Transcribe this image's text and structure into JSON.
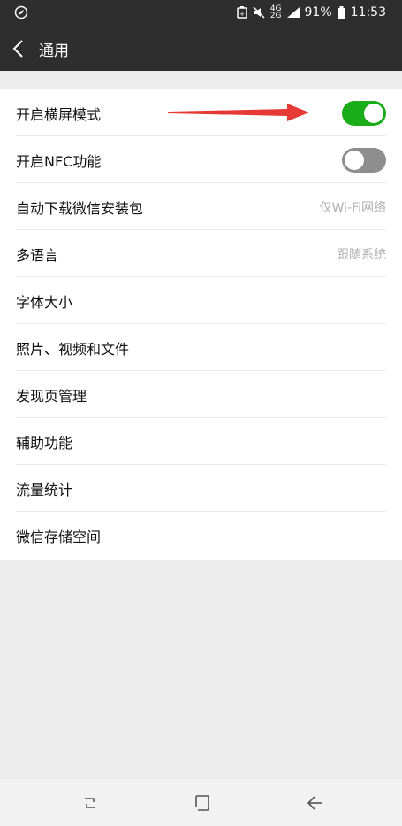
{
  "status_bar": {
    "network_top": "4G",
    "network_bottom": "2G",
    "battery": "91%",
    "time": "11:53"
  },
  "header": {
    "title": "通用"
  },
  "settings": [
    {
      "label": "开启横屏模式",
      "toggle": "on"
    },
    {
      "label": "开启NFC功能",
      "toggle": "off"
    },
    {
      "label": "自动下载微信安装包",
      "value": "仅Wi-Fi网络"
    },
    {
      "label": "多语言",
      "value": "跟随系统"
    },
    {
      "label": "字体大小"
    },
    {
      "label": "照片、视频和文件"
    },
    {
      "label": "发现页管理"
    },
    {
      "label": "辅助功能"
    },
    {
      "label": "流量统计"
    },
    {
      "label": "微信存储空间"
    }
  ],
  "colors": {
    "accent_green": "#1aad19",
    "annotation_arrow": "#e53935",
    "header_bg": "#2e2e2e"
  },
  "icons": [
    "compass-icon",
    "battery-saver-icon",
    "mute-icon",
    "signal-icon",
    "battery-icon",
    "back-arrow-icon",
    "recent-apps-icon",
    "home-icon",
    "back-icon"
  ]
}
